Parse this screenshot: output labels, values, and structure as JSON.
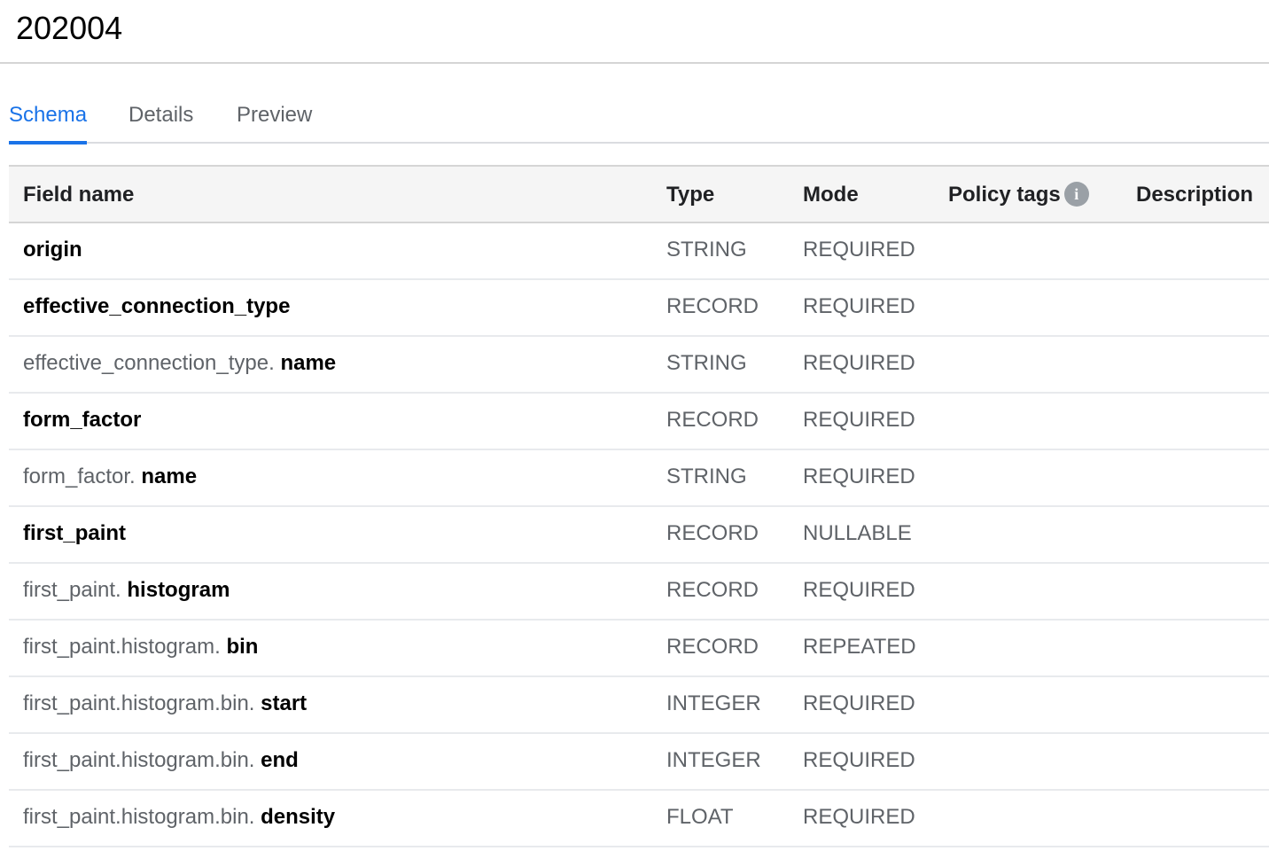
{
  "page": {
    "title": "202004"
  },
  "tabs": [
    {
      "label": "Schema",
      "active": true
    },
    {
      "label": "Details",
      "active": false
    },
    {
      "label": "Preview",
      "active": false
    }
  ],
  "table": {
    "headers": {
      "field_name": "Field name",
      "type": "Type",
      "mode": "Mode",
      "policy_tags": "Policy tags",
      "description": "Description"
    },
    "policy_tags_icon": "info-icon",
    "rows": [
      {
        "prefix": "",
        "name": "origin",
        "type": "STRING",
        "mode": "REQUIRED"
      },
      {
        "prefix": "",
        "name": "effective_connection_type",
        "type": "RECORD",
        "mode": "REQUIRED"
      },
      {
        "prefix": "effective_connection_type. ",
        "name": "name",
        "type": "STRING",
        "mode": "REQUIRED"
      },
      {
        "prefix": "",
        "name": "form_factor",
        "type": "RECORD",
        "mode": "REQUIRED"
      },
      {
        "prefix": "form_factor. ",
        "name": "name",
        "type": "STRING",
        "mode": "REQUIRED"
      },
      {
        "prefix": "",
        "name": "first_paint",
        "type": "RECORD",
        "mode": "NULLABLE"
      },
      {
        "prefix": "first_paint. ",
        "name": "histogram",
        "type": "RECORD",
        "mode": "REQUIRED"
      },
      {
        "prefix": "first_paint.histogram. ",
        "name": "bin",
        "type": "RECORD",
        "mode": "REPEATED"
      },
      {
        "prefix": "first_paint.histogram.bin. ",
        "name": "start",
        "type": "INTEGER",
        "mode": "REQUIRED"
      },
      {
        "prefix": "first_paint.histogram.bin. ",
        "name": "end",
        "type": "INTEGER",
        "mode": "REQUIRED"
      },
      {
        "prefix": "first_paint.histogram.bin. ",
        "name": "density",
        "type": "FLOAT",
        "mode": "REQUIRED"
      }
    ]
  },
  "colors": {
    "accent": "#1a73e8",
    "muted_text": "#5f6368",
    "header_bg": "#f5f5f5"
  }
}
